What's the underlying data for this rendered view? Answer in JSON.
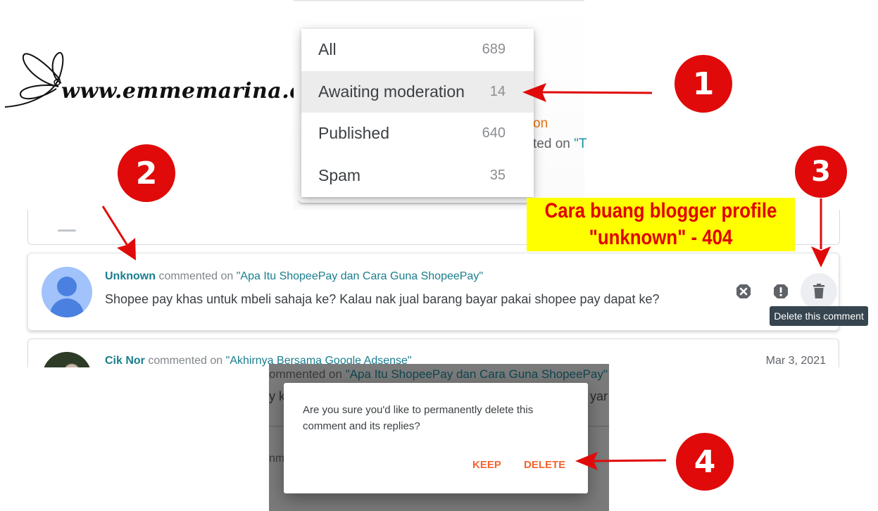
{
  "watermark": {
    "logo_text": "www.emmemarina.com"
  },
  "filter_menu": {
    "items": [
      {
        "label": "All",
        "count": "689",
        "active": false
      },
      {
        "label": "Awaiting moderation",
        "count": "14",
        "active": true
      },
      {
        "label": "Published",
        "count": "640",
        "active": false
      },
      {
        "label": "Spam",
        "count": "35",
        "active": false
      }
    ]
  },
  "background_fragment": {
    "orange_text": "on",
    "gray_text": "ted on ",
    "link_text": "\"T"
  },
  "comment": {
    "author": "Unknown",
    "commented_on": " commented on ",
    "post_title": "\"Apa Itu ShopeePay dan Cara Guna ShopeePay\"",
    "text": "Shopee pay khas untuk mbeli sahaja ke? Kalau nak jual barang bayar pakai shopee pay dapat ke?",
    "actions": {
      "reject_icon": "reject-icon",
      "spam_icon": "spam-icon",
      "delete_icon": "trash-icon"
    },
    "tooltip": "Delete this comment"
  },
  "next_comment": {
    "author": "Cik Nor",
    "commented_on": " commented on ",
    "post_title": "\"Akhirnya Bersama Google Adsense\"",
    "date": "Mar 3, 2021"
  },
  "annotation": {
    "banner_line1": "Cara buang blogger profile",
    "banner_line2": "\"unknown\" - 404",
    "steps": [
      "1",
      "2",
      "3",
      "4"
    ],
    "accent_color": "#e00a0a",
    "banner_bg": "#ffff00"
  },
  "dialog_backdrop": {
    "line1_prefix": "ommented on ",
    "line1_post": "\"Apa Itu ShopeePay dan Cara Guna ShopeePay\"",
    "line2_left": "y k",
    "line2_right": "yar",
    "line3": "nm"
  },
  "dialog": {
    "message": "Are you sure you'd like to permanently delete this comment and its replies?",
    "keep_label": "KEEP",
    "delete_label": "DELETE",
    "button_color": "#f26430"
  }
}
